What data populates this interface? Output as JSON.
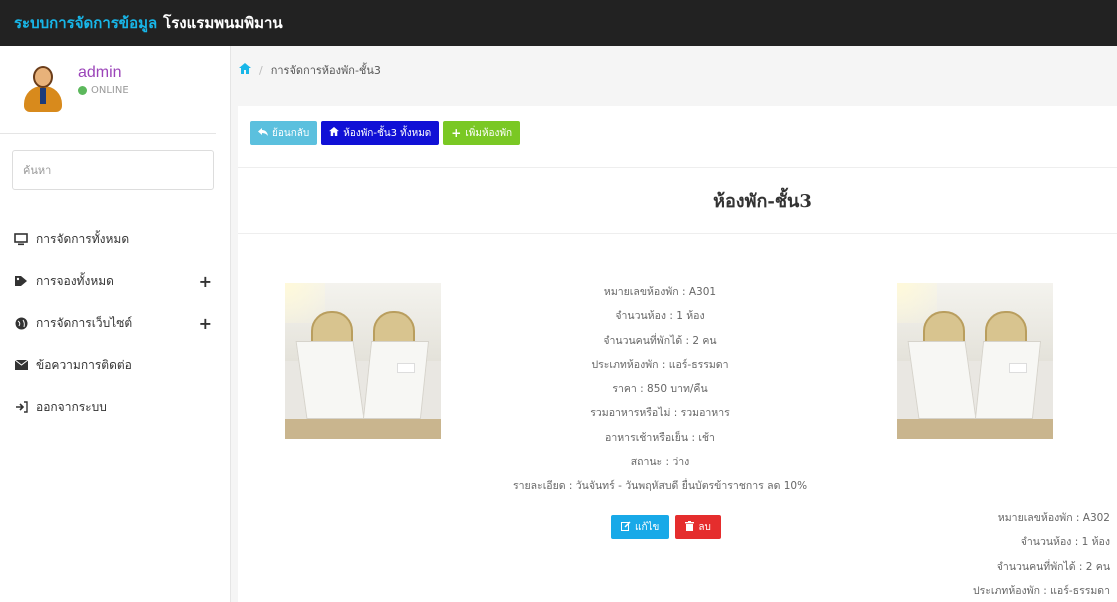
{
  "header": {
    "title_part1": "ระบบการจัดการข้อมูล",
    "title_part2": "โรงแรมพนมพิมาน"
  },
  "user": {
    "name": "admin",
    "status": "ONLINE",
    "status_color": "#5cb85c"
  },
  "search": {
    "placeholder": "ค้นหา"
  },
  "menu": [
    {
      "label": "การจัดการทั้งหมด",
      "icon": "monitor-icon",
      "expandable": false
    },
    {
      "label": "การจองทั้งหมด",
      "icon": "tag-icon",
      "expandable": true
    },
    {
      "label": "การจัดการเว็บไซต์",
      "icon": "globe-icon",
      "expandable": true
    },
    {
      "label": "ข้อความการติดต่อ",
      "icon": "envelope-icon",
      "expandable": false
    },
    {
      "label": "ออกจากระบบ",
      "icon": "sign-out-icon",
      "expandable": false
    }
  ],
  "breadcrumb": {
    "icon": "home-icon",
    "current": "การจัดการห้องพัก-ชั้น3"
  },
  "toolbar": {
    "back_label": "ย้อนกลับ",
    "all_label": "ห้องพัก-ชั้น3 ทั้งหมด",
    "add_label": "เพิ่มห้องพัก"
  },
  "page_title": "ห้องพัก-ชั้น3",
  "rooms": [
    {
      "lines": [
        "หมายเลขห้องพัก : A301",
        "จำนวนห้อง : 1 ห้อง",
        "จำนวนคนที่พักได้ : 2 คน",
        "ประเภทห้องพัก : แอร์-ธรรมดา",
        "ราคา : 850 บาท/คืน",
        "รวมอาหารหรือไม่ : รวมอาหาร",
        "อาหารเช้าหรือเย็น : เช้า",
        "สถานะ : ว่าง",
        "รายละเอียด : วันจันทร์ - วันพฤหัสบดี ยื่นบัตรข้าราชการ ลด 10%"
      ],
      "edit_label": "แก้ไข",
      "delete_label": "ลบ"
    },
    {
      "lines": [
        "หมายเลขห้องพัก : A302",
        "จำนวนห้อง : 1 ห้อง",
        "จำนวนคนที่พักได้ : 2 คน",
        "ประเภทห้องพัก : แอร์-ธรรมดา"
      ]
    }
  ]
}
